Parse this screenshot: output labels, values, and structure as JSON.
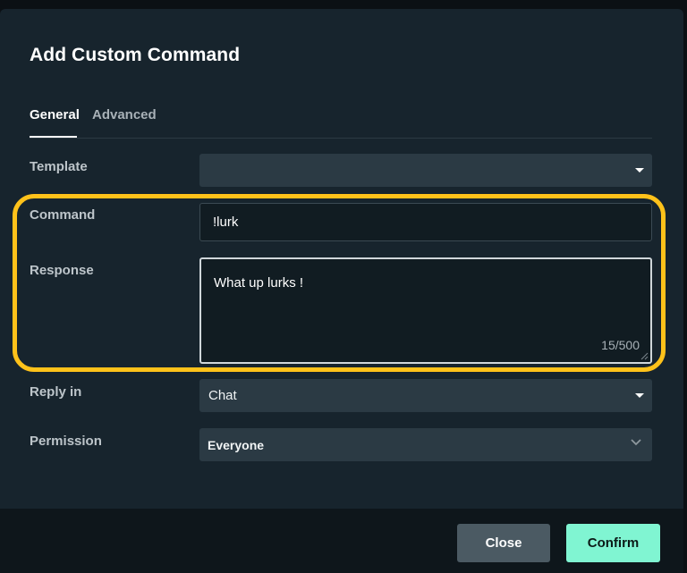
{
  "dialog": {
    "title": "Add Custom Command"
  },
  "tabs": [
    {
      "label": "General",
      "active": true
    },
    {
      "label": "Advanced",
      "active": false
    }
  ],
  "fields": {
    "template": {
      "label": "Template",
      "value": ""
    },
    "command": {
      "label": "Command",
      "value": "!lurk"
    },
    "response": {
      "label": "Response",
      "value": "What up lurks !",
      "counter": "15/500"
    },
    "reply_in": {
      "label": "Reply in",
      "value": "Chat"
    },
    "permission": {
      "label": "Permission",
      "value": "Everyone"
    }
  },
  "footer": {
    "close_label": "Close",
    "confirm_label": "Confirm"
  },
  "colors": {
    "highlight": "#ffc21a",
    "confirm": "#80f5d2",
    "background": "#17242d"
  },
  "icons": {
    "template_dropdown": "caret-down-icon",
    "reply_dropdown": "caret-down-icon",
    "permission_dropdown": "chevron-down-icon"
  }
}
